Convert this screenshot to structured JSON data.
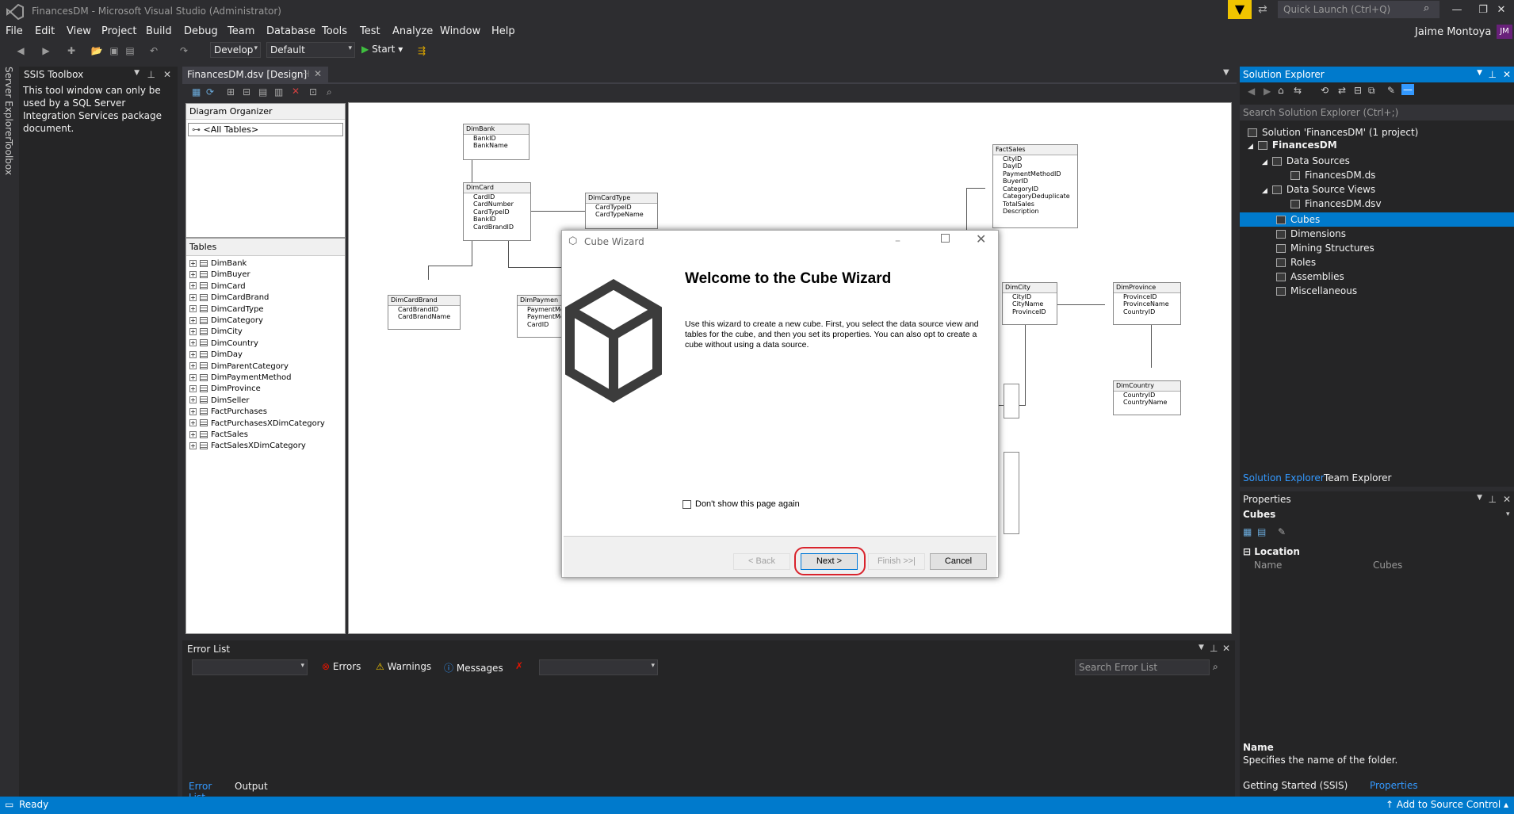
{
  "window": {
    "title": "FinancesDM - Microsoft Visual Studio  (Administrator)",
    "quick_launch_placeholder": "Quick Launch (Ctrl+Q)",
    "user": "Jaime Montoya",
    "user_initials": "JM"
  },
  "menu": [
    "File",
    "Edit",
    "View",
    "Project",
    "Build",
    "Debug",
    "Team",
    "Database",
    "Tools",
    "Test",
    "Analyze",
    "Window",
    "Help"
  ],
  "toolbar": {
    "config": "Develop",
    "platform": "Default",
    "start_label": "Start"
  },
  "left_strip": {
    "server_explorer": "Server Explorer",
    "toolbox": "Toolbox"
  },
  "ssis_toolbox": {
    "title": "SSIS Toolbox",
    "message": "This tool window can only be used by a SQL Server Integration Services package document."
  },
  "document_tab": {
    "title": "FinancesDM.dsv [Design]"
  },
  "diagram_organizer": {
    "title": "Diagram Organizer",
    "item": "<All Tables>"
  },
  "tables_panel": {
    "title": "Tables",
    "items": [
      "DimBank",
      "DimBuyer",
      "DimCard",
      "DimCardBrand",
      "DimCardType",
      "DimCategory",
      "DimCity",
      "DimCountry",
      "DimDay",
      "DimParentCategory",
      "DimPaymentMethod",
      "DimProvince",
      "DimSeller",
      "FactPurchases",
      "FactPurchasesXDimCategory",
      "FactSales",
      "FactSalesXDimCategory"
    ]
  },
  "diagram": {
    "dimbank": {
      "name": "DimBank",
      "fields": [
        "BankID",
        "BankName"
      ]
    },
    "dimcard": {
      "name": "DimCard",
      "fields": [
        "CardID",
        "CardNumber",
        "CardTypeID",
        "BankID",
        "CardBrandID"
      ]
    },
    "dimcardtype": {
      "name": "DimCardType",
      "fields": [
        "CardTypeID",
        "CardTypeName"
      ]
    },
    "dimcardbrand": {
      "name": "DimCardBrand",
      "fields": [
        "CardBrandID",
        "CardBrandName"
      ]
    },
    "dimpayment": {
      "name": "DimPaymen",
      "fields": [
        "PaymentMe",
        "PaymentMe",
        "CardID"
      ]
    },
    "factsales": {
      "name": "FactSales",
      "fields": [
        "CityID",
        "DayID",
        "PaymentMethodID",
        "BuyerID",
        "CategoryID",
        "CategoryDeduplicate",
        "TotalSales",
        "Description"
      ]
    },
    "dimcity": {
      "name": "DimCity",
      "fields": [
        "CityID",
        "CityName",
        "ProvinceID"
      ]
    },
    "dimprovince": {
      "name": "DimProvince",
      "fields": [
        "ProvinceID",
        "ProvinceName",
        "CountryID"
      ]
    },
    "dimcountry": {
      "name": "DimCountry",
      "fields": [
        "CountryID",
        "CountryName"
      ]
    }
  },
  "wizard": {
    "title": "Cube Wizard",
    "heading": "Welcome to the Cube Wizard",
    "description": "Use this wizard to create a new cube. First, you select the data source view and tables for the cube, and then you set its properties. You can also opt to create a cube without using a data source.",
    "checkbox_label": "Don't show this page again",
    "back": "< Back",
    "next": "Next >",
    "finish": "Finish >>|",
    "cancel": "Cancel"
  },
  "solution_explorer": {
    "title": "Solution Explorer",
    "search_placeholder": "Search Solution Explorer (Ctrl+;)",
    "solution": "Solution 'FinancesDM' (1 project)",
    "project": "FinancesDM",
    "data_sources": "Data Sources",
    "data_source_file": "FinancesDM.ds",
    "data_source_views": "Data Source Views",
    "dsv_file": "FinancesDM.dsv",
    "cubes": "Cubes",
    "dimensions": "Dimensions",
    "mining": "Mining Structures",
    "roles": "Roles",
    "assemblies": "Assemblies",
    "misc": "Miscellaneous",
    "tab1": "Solution Explorer",
    "tab2": "Team Explorer"
  },
  "properties": {
    "title": "Properties",
    "object": "Cubes",
    "category": "Location",
    "name_label": "Name",
    "name_value": "Cubes",
    "desc_title": "Name",
    "desc_text": "Specifies the name of the folder.",
    "tab1": "Getting Started (SSIS)",
    "tab2": "Properties"
  },
  "error_list": {
    "title": "Error List",
    "errors": "Errors",
    "warnings": "Warnings",
    "messages": "Messages",
    "search_placeholder": "Search Error List",
    "tab1": "Error List",
    "tab2": "Output"
  },
  "status": {
    "ready": "Ready",
    "source_control": "Add to Source Control"
  },
  "colors": {
    "accent": "#007acc",
    "highlight_ring": "#d9232c"
  }
}
